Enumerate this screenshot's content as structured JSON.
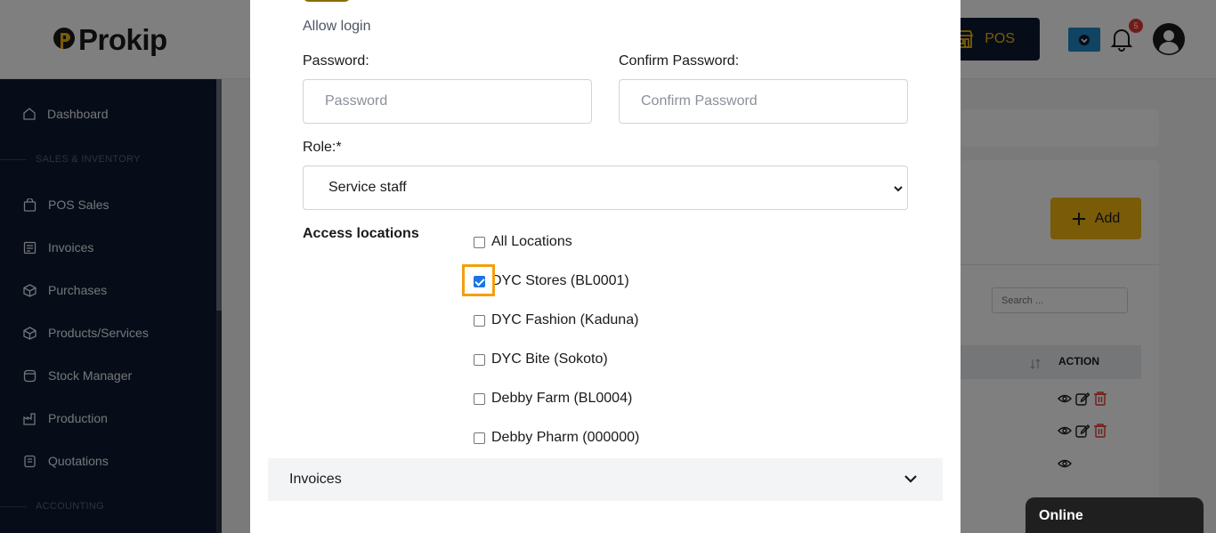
{
  "header": {
    "logo_text": "Prokip",
    "pos_label": "POS",
    "notification_count": "5"
  },
  "sidebar": {
    "items": [
      {
        "label": "Dashboard"
      },
      {
        "label": "POS Sales"
      },
      {
        "label": "Invoices"
      },
      {
        "label": "Purchases"
      },
      {
        "label": "Products/Services"
      },
      {
        "label": "Stock Manager"
      },
      {
        "label": "Production"
      },
      {
        "label": "Quotations"
      }
    ],
    "sections": [
      "SALES & INVENTORY",
      "ACCOUNTING"
    ]
  },
  "background": {
    "add_label": "Add",
    "search_placeholder": "Search ...",
    "action_header": "ACTION"
  },
  "modal": {
    "allow_login_label": "Allow login",
    "password_label": "Password:",
    "password_placeholder": "Password",
    "confirm_password_label": "Confirm Password:",
    "confirm_password_placeholder": "Confirm Password",
    "role_label": "Role:*",
    "role_selected": "Service staff",
    "access_locations_label": "Access locations",
    "locations": [
      {
        "label": "All Locations",
        "checked": false
      },
      {
        "label": "DYC Stores (BL0001)",
        "checked": true
      },
      {
        "label": "DYC Fashion (Kaduna)",
        "checked": false
      },
      {
        "label": "DYC Bite (Sokoto)",
        "checked": false
      },
      {
        "label": "Debby Farm (BL0004)",
        "checked": false
      },
      {
        "label": "Debby Pharm (000000)",
        "checked": false
      }
    ],
    "accordion_label": "Invoices"
  },
  "chat": {
    "status": "Online"
  },
  "colors": {
    "brand_yellow": "#f3b711",
    "navy": "#0d1b33",
    "highlight": "#f59e0b",
    "checkbox_blue": "#1a73e8"
  }
}
